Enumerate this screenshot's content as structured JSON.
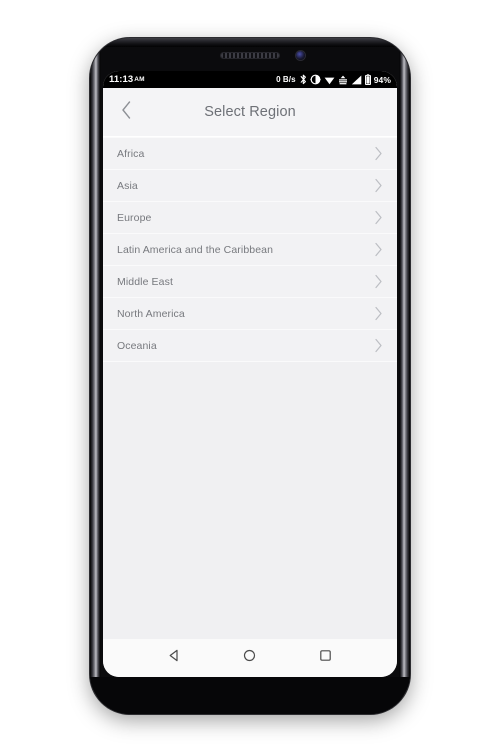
{
  "device": {
    "name": "android-phone",
    "earpiece": "speaker-grille",
    "front_camera": "front-camera"
  },
  "status_bar": {
    "time": "11:13",
    "ampm": "AM",
    "network_speed": "0 B/s",
    "battery_percent": "94%",
    "icons": [
      "bluetooth-icon",
      "contrast-icon",
      "wifi-icon",
      "data-transfer-icon",
      "signal-bars-icon",
      "battery-icon"
    ],
    "background": "#000000",
    "foreground": "#ffffff"
  },
  "app_bar": {
    "back_label": "back-chevron",
    "title": "Select Region",
    "title_color": "#6e7177",
    "background": "#f4f4f6"
  },
  "list": {
    "items": [
      {
        "label": "Africa"
      },
      {
        "label": "Asia"
      },
      {
        "label": "Europe"
      },
      {
        "label": "Latin America and the Caribbean"
      },
      {
        "label": "Middle East"
      },
      {
        "label": "North America"
      },
      {
        "label": "Oceania"
      }
    ],
    "row_background": "#f2f2f4",
    "label_color": "#77797e",
    "chevron": "chevron-right-icon"
  },
  "nav_bar": {
    "back": "back-triangle-icon",
    "home": "home-circle-icon",
    "recents": "recents-square-icon",
    "background": "#fafafa",
    "icon_color": "#4b4b4b"
  }
}
